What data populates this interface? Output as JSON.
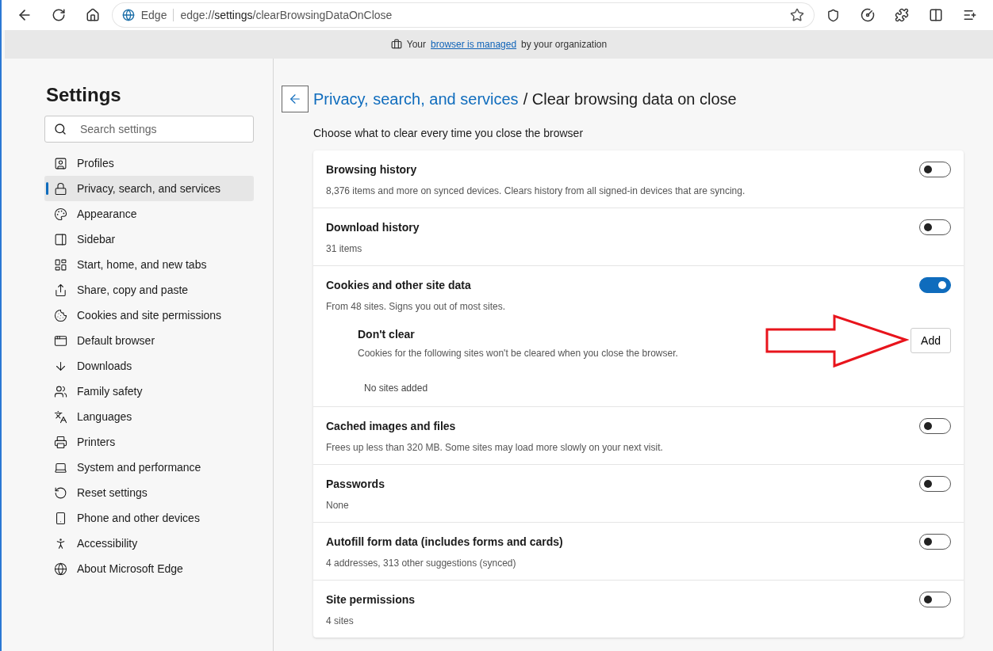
{
  "browser": {
    "brand": "Edge",
    "url_prefix": "edge://",
    "url_bold": "settings",
    "url_rest": "/clearBrowsingDataOnClose"
  },
  "banner": {
    "before": "Your",
    "link": "browser is managed",
    "after": "by your organization"
  },
  "sidebar": {
    "title": "Settings",
    "search": {
      "placeholder": "Search settings"
    },
    "items": [
      {
        "label": "Profiles",
        "selected": false
      },
      {
        "label": "Privacy, search, and services",
        "selected": true
      },
      {
        "label": "Appearance",
        "selected": false
      },
      {
        "label": "Sidebar",
        "selected": false
      },
      {
        "label": "Start, home, and new tabs",
        "selected": false
      },
      {
        "label": "Share, copy and paste",
        "selected": false
      },
      {
        "label": "Cookies and site permissions",
        "selected": false
      },
      {
        "label": "Default browser",
        "selected": false
      },
      {
        "label": "Downloads",
        "selected": false
      },
      {
        "label": "Family safety",
        "selected": false
      },
      {
        "label": "Languages",
        "selected": false
      },
      {
        "label": "Printers",
        "selected": false
      },
      {
        "label": "System and performance",
        "selected": false
      },
      {
        "label": "Reset settings",
        "selected": false
      },
      {
        "label": "Phone and other devices",
        "selected": false
      },
      {
        "label": "Accessibility",
        "selected": false
      },
      {
        "label": "About Microsoft Edge",
        "selected": false
      }
    ]
  },
  "page": {
    "breadcrumb": "Privacy, search, and services",
    "title": "/ Clear browsing data on close",
    "intro": "Choose what to clear every time you close the browser"
  },
  "items": [
    {
      "title": "Browsing history",
      "description": "8,376 items and more on synced devices. Clears history from all signed-in devices that are syncing.",
      "on": false
    },
    {
      "title": "Download history",
      "description": "31 items",
      "on": false
    },
    {
      "title": "Cookies and other site data",
      "description": "From 48 sites. Signs you out of most sites.",
      "on": true,
      "dont_clear": {
        "title": "Don't clear",
        "description": "Cookies for the following sites won't be cleared when you close the browser.",
        "button": "Add",
        "empty": "No sites added"
      }
    },
    {
      "title": "Cached images and files",
      "description": "Frees up less than 320 MB. Some sites may load more slowly on your next visit.",
      "on": false
    },
    {
      "title": "Passwords",
      "description": "None",
      "on": false
    },
    {
      "title": "Autofill form data (includes forms and cards)",
      "description": "4 addresses, 313 other suggestions (synced)",
      "on": false
    },
    {
      "title": "Site permissions",
      "description": "4 sites",
      "on": false
    }
  ]
}
